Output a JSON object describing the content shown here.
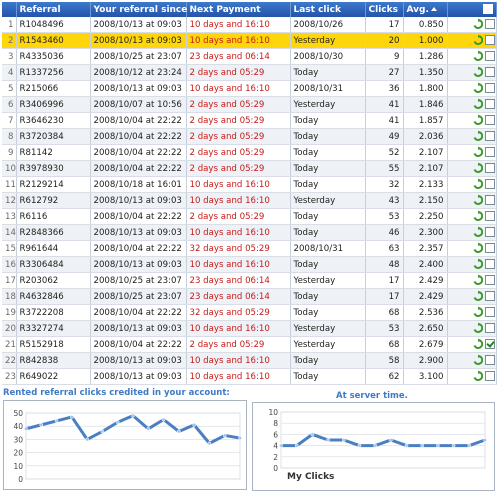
{
  "table": {
    "headers": {
      "referral": "Referral",
      "since": "Your referral since",
      "payment": "Next Payment",
      "last_click": "Last click",
      "clicks": "Clicks",
      "avg": "Avg."
    },
    "rows": [
      {
        "n": "1",
        "ref": "R1048496",
        "since": "2008/10/13 at 09:03",
        "pay": "10 days and 16:10",
        "last": "2008/10/26",
        "clicks": "17",
        "avg": "0.850",
        "checked": false,
        "highlight": false
      },
      {
        "n": "2",
        "ref": "R1543460",
        "since": "2008/10/13 at 09:03",
        "pay": "10 days and 16:10",
        "last": "Yesterday",
        "clicks": "20",
        "avg": "1.000",
        "checked": false,
        "highlight": true
      },
      {
        "n": "3",
        "ref": "R4335036",
        "since": "2008/10/25 at 23:07",
        "pay": "23 days and 06:14",
        "last": "2008/10/30",
        "clicks": "9",
        "avg": "1.286",
        "checked": false,
        "highlight": false
      },
      {
        "n": "4",
        "ref": "R1337256",
        "since": "2008/10/12 at 23:24",
        "pay": "2 days and 05:29",
        "last": "Today",
        "clicks": "27",
        "avg": "1.350",
        "checked": false,
        "highlight": false
      },
      {
        "n": "5",
        "ref": "R215066",
        "since": "2008/10/13 at 09:03",
        "pay": "10 days and 16:10",
        "last": "2008/10/31",
        "clicks": "36",
        "avg": "1.800",
        "checked": false,
        "highlight": false
      },
      {
        "n": "6",
        "ref": "R3406996",
        "since": "2008/10/07 at 10:56",
        "pay": "2 days and 05:29",
        "last": "Yesterday",
        "clicks": "41",
        "avg": "1.846",
        "checked": false,
        "highlight": false
      },
      {
        "n": "7",
        "ref": "R3646230",
        "since": "2008/10/04 at 22:22",
        "pay": "2 days and 05:29",
        "last": "Today",
        "clicks": "41",
        "avg": "1.857",
        "checked": false,
        "highlight": false
      },
      {
        "n": "8",
        "ref": "R3720384",
        "since": "2008/10/04 at 22:22",
        "pay": "2 days and 05:29",
        "last": "Today",
        "clicks": "49",
        "avg": "2.036",
        "checked": false,
        "highlight": false
      },
      {
        "n": "9",
        "ref": "R81142",
        "since": "2008/10/04 at 22:22",
        "pay": "2 days and 05:29",
        "last": "Today",
        "clicks": "52",
        "avg": "2.107",
        "checked": false,
        "highlight": false
      },
      {
        "n": "10",
        "ref": "R3978930",
        "since": "2008/10/04 at 22:22",
        "pay": "2 days and 05:29",
        "last": "Today",
        "clicks": "55",
        "avg": "2.107",
        "checked": false,
        "highlight": false
      },
      {
        "n": "11",
        "ref": "R2129214",
        "since": "2008/10/18 at 16:01",
        "pay": "10 days and 16:10",
        "last": "Today",
        "clicks": "32",
        "avg": "2.133",
        "checked": false,
        "highlight": false
      },
      {
        "n": "12",
        "ref": "R612792",
        "since": "2008/10/13 at 09:03",
        "pay": "10 days and 16:10",
        "last": "Yesterday",
        "clicks": "43",
        "avg": "2.150",
        "checked": false,
        "highlight": false
      },
      {
        "n": "13",
        "ref": "R6116",
        "since": "2008/10/04 at 22:22",
        "pay": "2 days and 05:29",
        "last": "Today",
        "clicks": "53",
        "avg": "2.250",
        "checked": false,
        "highlight": false
      },
      {
        "n": "14",
        "ref": "R2848366",
        "since": "2008/10/13 at 09:03",
        "pay": "10 days and 16:10",
        "last": "Today",
        "clicks": "46",
        "avg": "2.300",
        "checked": false,
        "highlight": false
      },
      {
        "n": "15",
        "ref": "R961644",
        "since": "2008/10/04 at 22:22",
        "pay": "32 days and 05:29",
        "last": "2008/10/31",
        "clicks": "63",
        "avg": "2.357",
        "checked": false,
        "highlight": false
      },
      {
        "n": "16",
        "ref": "R3306484",
        "since": "2008/10/13 at 09:03",
        "pay": "10 days and 16:10",
        "last": "Today",
        "clicks": "48",
        "avg": "2.400",
        "checked": false,
        "highlight": false
      },
      {
        "n": "17",
        "ref": "R203062",
        "since": "2008/10/25 at 23:07",
        "pay": "23 days and 06:14",
        "last": "Yesterday",
        "clicks": "17",
        "avg": "2.429",
        "checked": false,
        "highlight": false
      },
      {
        "n": "18",
        "ref": "R4632846",
        "since": "2008/10/25 at 23:07",
        "pay": "23 days and 06:14",
        "last": "Today",
        "clicks": "17",
        "avg": "2.429",
        "checked": false,
        "highlight": false
      },
      {
        "n": "19",
        "ref": "R3722208",
        "since": "2008/10/04 at 22:22",
        "pay": "32 days and 05:29",
        "last": "Today",
        "clicks": "68",
        "avg": "2.536",
        "checked": false,
        "highlight": false
      },
      {
        "n": "20",
        "ref": "R3327274",
        "since": "2008/10/13 at 09:03",
        "pay": "10 days and 16:10",
        "last": "Yesterday",
        "clicks": "53",
        "avg": "2.650",
        "checked": false,
        "highlight": false
      },
      {
        "n": "21",
        "ref": "R5152918",
        "since": "2008/10/04 at 22:22",
        "pay": "2 days and 05:29",
        "last": "Yesterday",
        "clicks": "68",
        "avg": "2.679",
        "checked": true,
        "highlight": false
      },
      {
        "n": "22",
        "ref": "R842838",
        "since": "2008/10/13 at 09:03",
        "pay": "10 days and 16:10",
        "last": "Today",
        "clicks": "58",
        "avg": "2.900",
        "checked": false,
        "highlight": false
      },
      {
        "n": "23",
        "ref": "R649022",
        "since": "2008/10/13 at 09:03",
        "pay": "10 days and 16:10",
        "last": "Today",
        "clicks": "62",
        "avg": "3.100",
        "checked": false,
        "highlight": false
      }
    ]
  },
  "charts": {
    "left_title": "Rented referral clicks credited in your account:",
    "right_title": "At server time.",
    "right_legend": "My Clicks"
  },
  "chart_data": [
    {
      "type": "line",
      "title": "Rented referral clicks credited in your account:",
      "ylim": [
        0,
        50
      ],
      "yticks": [
        0,
        10,
        20,
        30,
        40,
        50
      ],
      "series": [
        {
          "values": [
            38,
            41,
            44,
            47,
            30,
            36,
            43,
            48,
            38,
            45,
            36,
            41,
            27,
            33,
            31
          ]
        }
      ],
      "grid": true,
      "colors": {
        "line": "#4a7fc1",
        "marker": "#9dc3e6"
      }
    },
    {
      "type": "line",
      "title": "At server time.",
      "ylim": [
        0,
        10
      ],
      "yticks": [
        0,
        2,
        4,
        6,
        8,
        10
      ],
      "series": [
        {
          "name": "My Clicks",
          "values": [
            4,
            4,
            6,
            5,
            5,
            4,
            4,
            5,
            4,
            4,
            4,
            4,
            4,
            5
          ]
        }
      ],
      "grid": true,
      "colors": {
        "line": "#4a7fc1",
        "marker": "#9dc3e6"
      }
    }
  ]
}
